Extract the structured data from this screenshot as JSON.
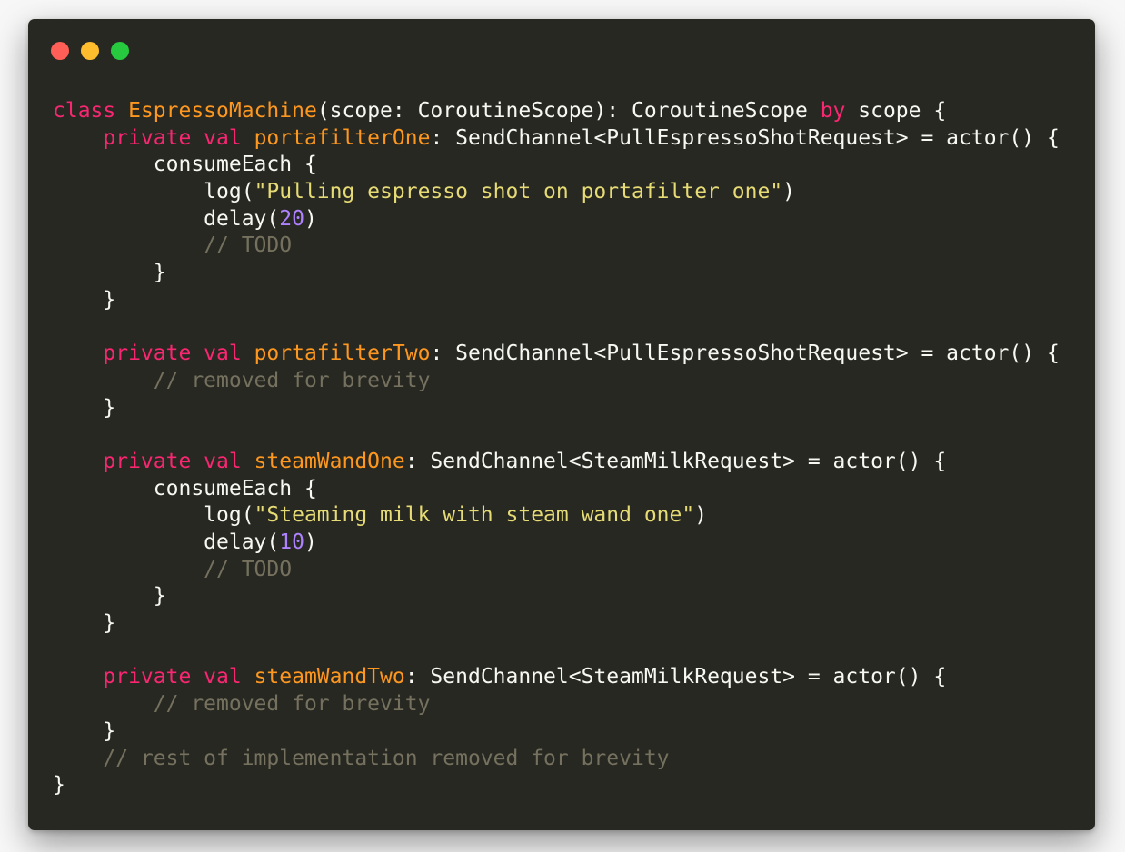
{
  "window": {
    "controls": [
      {
        "name": "close-button",
        "color": "#ff5f56"
      },
      {
        "name": "minimize-button",
        "color": "#ffbd2e"
      },
      {
        "name": "maximize-button",
        "color": "#27c93f"
      }
    ]
  },
  "theme": {
    "background": "#272822",
    "text": "#f8f8f2",
    "keyword": "#f92672",
    "identifier": "#fd971f",
    "string": "#e6db74",
    "number": "#ae81ff",
    "comment": "#75715e"
  },
  "code": {
    "lines": [
      [
        {
          "t": "kw",
          "v": "class "
        },
        {
          "t": "cls",
          "v": "EspressoMachine"
        },
        {
          "t": "txt",
          "v": "(scope: CoroutineScope): CoroutineScope "
        },
        {
          "t": "kw",
          "v": "by"
        },
        {
          "t": "txt",
          "v": " scope {"
        }
      ],
      [
        {
          "t": "txt",
          "v": "    "
        },
        {
          "t": "kw",
          "v": "private val "
        },
        {
          "t": "cls",
          "v": "portafilterOne"
        },
        {
          "t": "txt",
          "v": ": SendChannel<PullEspressoShotRequest> = actor() {"
        }
      ],
      [
        {
          "t": "txt",
          "v": "        consumeEach {"
        }
      ],
      [
        {
          "t": "txt",
          "v": "            log("
        },
        {
          "t": "str",
          "v": "\"Pulling espresso shot on portafilter one\""
        },
        {
          "t": "txt",
          "v": ")"
        }
      ],
      [
        {
          "t": "txt",
          "v": "            delay("
        },
        {
          "t": "num",
          "v": "20"
        },
        {
          "t": "txt",
          "v": ")"
        }
      ],
      [
        {
          "t": "txt",
          "v": "            "
        },
        {
          "t": "com",
          "v": "// TODO"
        }
      ],
      [
        {
          "t": "txt",
          "v": "        }"
        }
      ],
      [
        {
          "t": "txt",
          "v": "    }"
        }
      ],
      [],
      [
        {
          "t": "txt",
          "v": "    "
        },
        {
          "t": "kw",
          "v": "private val "
        },
        {
          "t": "cls",
          "v": "portafilterTwo"
        },
        {
          "t": "txt",
          "v": ": SendChannel<PullEspressoShotRequest> = actor() {"
        }
      ],
      [
        {
          "t": "txt",
          "v": "        "
        },
        {
          "t": "com",
          "v": "// removed for brevity"
        }
      ],
      [
        {
          "t": "txt",
          "v": "    }"
        }
      ],
      [],
      [
        {
          "t": "txt",
          "v": "    "
        },
        {
          "t": "kw",
          "v": "private val "
        },
        {
          "t": "cls",
          "v": "steamWandOne"
        },
        {
          "t": "txt",
          "v": ": SendChannel<SteamMilkRequest> = actor() {"
        }
      ],
      [
        {
          "t": "txt",
          "v": "        consumeEach {"
        }
      ],
      [
        {
          "t": "txt",
          "v": "            log("
        },
        {
          "t": "str",
          "v": "\"Steaming milk with steam wand one\""
        },
        {
          "t": "txt",
          "v": ")"
        }
      ],
      [
        {
          "t": "txt",
          "v": "            delay("
        },
        {
          "t": "num",
          "v": "10"
        },
        {
          "t": "txt",
          "v": ")"
        }
      ],
      [
        {
          "t": "txt",
          "v": "            "
        },
        {
          "t": "com",
          "v": "// TODO"
        }
      ],
      [
        {
          "t": "txt",
          "v": "        }"
        }
      ],
      [
        {
          "t": "txt",
          "v": "    }"
        }
      ],
      [],
      [
        {
          "t": "txt",
          "v": "    "
        },
        {
          "t": "kw",
          "v": "private val "
        },
        {
          "t": "cls",
          "v": "steamWandTwo"
        },
        {
          "t": "txt",
          "v": ": SendChannel<SteamMilkRequest> = actor() {"
        }
      ],
      [
        {
          "t": "txt",
          "v": "        "
        },
        {
          "t": "com",
          "v": "// removed for brevity"
        }
      ],
      [
        {
          "t": "txt",
          "v": "    }"
        }
      ],
      [
        {
          "t": "txt",
          "v": "    "
        },
        {
          "t": "com",
          "v": "// rest of implementation removed for brevity"
        }
      ],
      [
        {
          "t": "txt",
          "v": "}"
        }
      ]
    ]
  }
}
